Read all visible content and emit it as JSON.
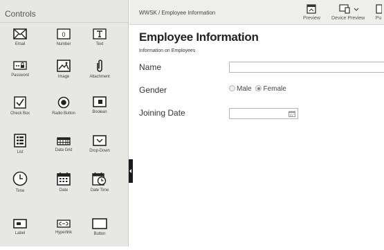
{
  "panel": {
    "title": "Controls",
    "controls": [
      {
        "label": "Email",
        "icon": "email-icon"
      },
      {
        "label": "Number",
        "icon": "number-icon"
      },
      {
        "label": "Text",
        "icon": "text-icon"
      },
      {
        "label": "Password",
        "icon": "password-icon"
      },
      {
        "label": "Image",
        "icon": "image-icon"
      },
      {
        "label": "Attachment",
        "icon": "attachment-icon"
      },
      {
        "label": "Check Box",
        "icon": "checkbox-icon"
      },
      {
        "label": "Radio Button",
        "icon": "radio-button-icon"
      },
      {
        "label": "Boolean",
        "icon": "boolean-icon"
      },
      {
        "label": "List",
        "icon": "list-icon"
      },
      {
        "label": "Data Grid",
        "icon": "data-grid-icon"
      },
      {
        "label": "Drop-Down",
        "icon": "dropdown-icon"
      },
      {
        "label": "Time",
        "icon": "clock-icon"
      },
      {
        "label": "Date",
        "icon": "calendar-icon"
      },
      {
        "label": "Date Time",
        "icon": "date-time-icon"
      },
      {
        "label": "Label",
        "icon": "label-icon"
      },
      {
        "label": "Hyperlink",
        "icon": "hyperlink-icon"
      },
      {
        "label": "Button",
        "icon": "button-icon"
      }
    ]
  },
  "topbar": {
    "breadcrumb": "WWSK / Employee Information",
    "preview_label": "Preview",
    "device_preview_label": "Device Preview",
    "publish_label": "Pu"
  },
  "form": {
    "title": "Employee Information",
    "subtitle": "Information on Employees",
    "name_label": "Name",
    "name_value": "",
    "gender_label": "Gender",
    "gender_options": [
      "Male",
      "Female"
    ],
    "gender_selected": "Female",
    "joining_date_label": "Joining Date",
    "joining_date_value": ""
  }
}
